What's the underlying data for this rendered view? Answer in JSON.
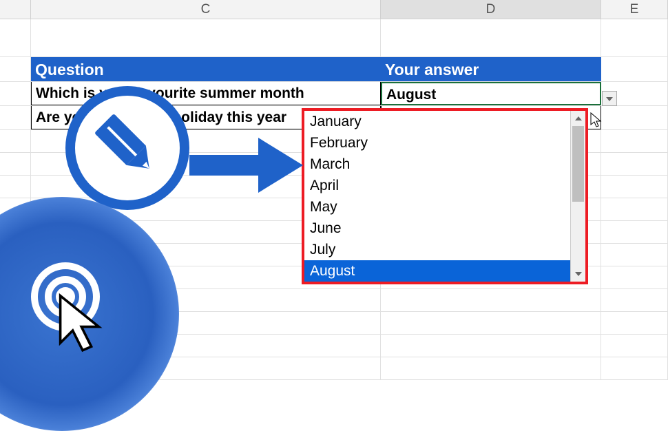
{
  "columns": {
    "c": "C",
    "d": "D",
    "e": "E"
  },
  "headers": {
    "question": "Question",
    "answer": "Your answer"
  },
  "rows": [
    {
      "question": "Which is your favourite summer month",
      "answer": "August"
    },
    {
      "question": "Are you going for a holiday this year",
      "answer": ""
    }
  ],
  "dropdown": {
    "items": [
      "January",
      "February",
      "March",
      "April",
      "May",
      "June",
      "July",
      "August"
    ],
    "selected": "August"
  },
  "colors": {
    "header_bg": "#1f62c9",
    "highlight_border": "#ed1c24",
    "selection": "#0a64d8"
  }
}
